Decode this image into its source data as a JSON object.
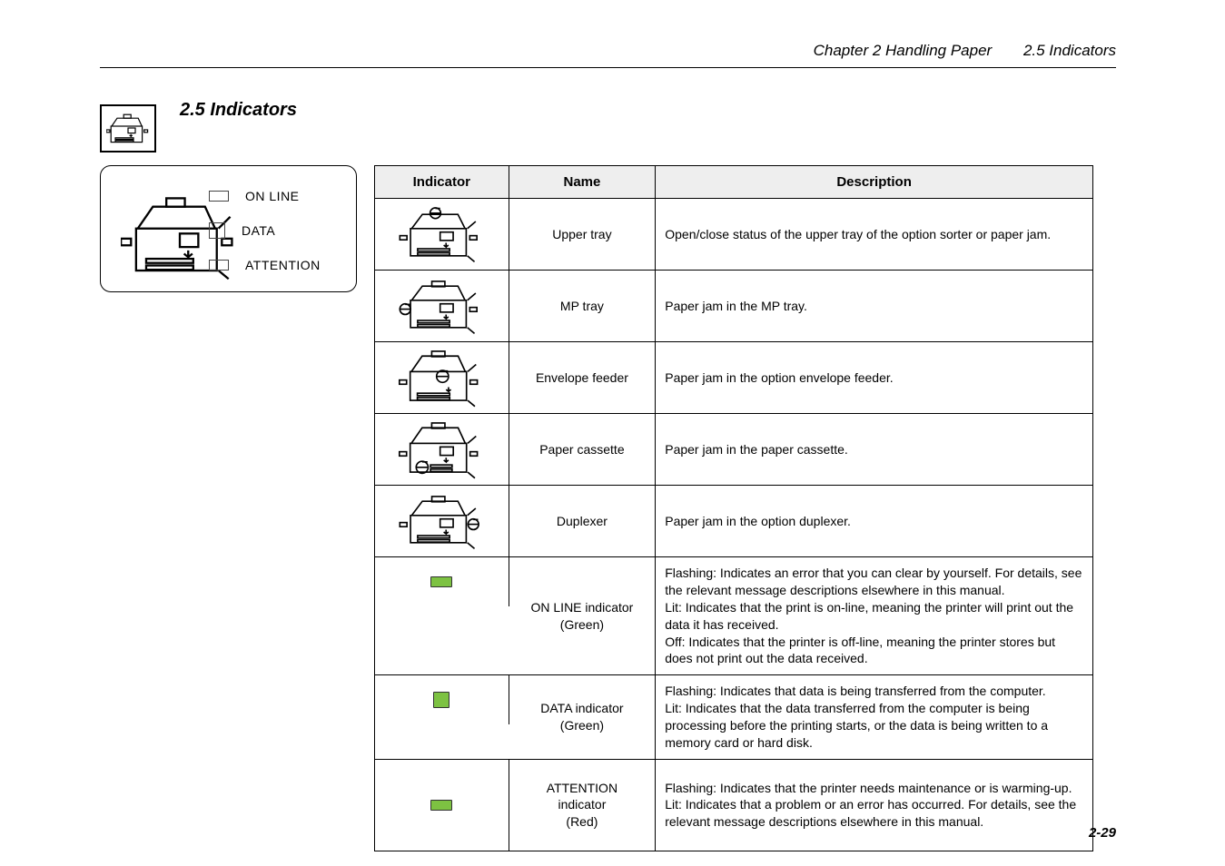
{
  "header": {
    "chapter": "Chapter 2 Handling Paper",
    "section": "2.5 Indicators"
  },
  "page_number": "2-29",
  "heading": "2.5 Indicators",
  "panel": {
    "leds": [
      "ON LINE",
      "DATA",
      "ATTENTION"
    ]
  },
  "table": {
    "headers": [
      "Indicator",
      "Name",
      "Description"
    ],
    "rows": [
      {
        "name": "Upper tray",
        "desc": "Open/close status of the upper tray of the option sorter or paper jam."
      },
      {
        "name": "MP tray",
        "desc": "Paper jam in the MP tray."
      },
      {
        "name": "Envelope feeder",
        "desc": "Paper jam in the option envelope feeder."
      },
      {
        "name": "Paper cassette",
        "desc": "Paper jam in the paper cassette."
      },
      {
        "name": "Duplexer",
        "desc": "Paper jam in the option duplexer."
      },
      {
        "name_lines": [
          "ON LINE indicator",
          "(Green)"
        ],
        "desc_lines": [
          "Flashing: Indicates an error that you can clear by yourself. For details, see the relevant message descriptions elsewhere in this manual.",
          "Lit: Indicates that the print is on-line, meaning the printer will print out the data it has received.",
          "Off: Indicates that the printer is off-line, meaning the printer stores but does not print out the data received."
        ]
      },
      {
        "name_lines": [
          "DATA indicator",
          "(Green)"
        ],
        "desc_lines": [
          "Flashing: Indicates that data is being transferred from the computer.",
          "Lit: Indicates that the data transferred from the computer is being processing before the printing starts, or the data is being written to a memory card or hard disk."
        ]
      },
      {
        "name_lines": [
          "ATTENTION",
          "indicator",
          "(Red)"
        ],
        "desc_lines": [
          "Flashing: Indicates that the printer needs maintenance or is warming-up.",
          "Lit: Indicates that a problem or an error has occurred. For details, see the relevant message descriptions elsewhere in this manual."
        ]
      }
    ]
  }
}
